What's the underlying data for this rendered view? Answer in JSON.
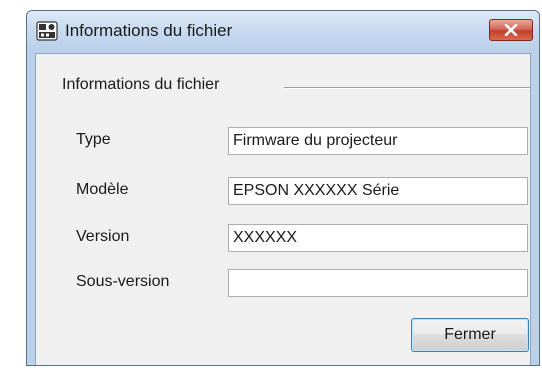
{
  "window": {
    "title": "Informations du fichier",
    "icon": "projector-app-icon",
    "close_icon": "close-x-icon"
  },
  "group": {
    "label": "Informations du fichier"
  },
  "fields": {
    "type": {
      "label": "Type",
      "value": "Firmware du projecteur"
    },
    "model": {
      "label": "Modèle",
      "value": "EPSON XXXXXX Série"
    },
    "version": {
      "label": "Version",
      "value": "XXXXXX"
    },
    "subversion": {
      "label": "Sous-version",
      "value": ""
    }
  },
  "buttons": {
    "close_label": "Fermer"
  },
  "colors": {
    "title_bar": "#c6d9ef",
    "close_button": "#c2402c",
    "dialog_body": "#f0f0f0",
    "default_button_border": "#3c7fb1"
  }
}
